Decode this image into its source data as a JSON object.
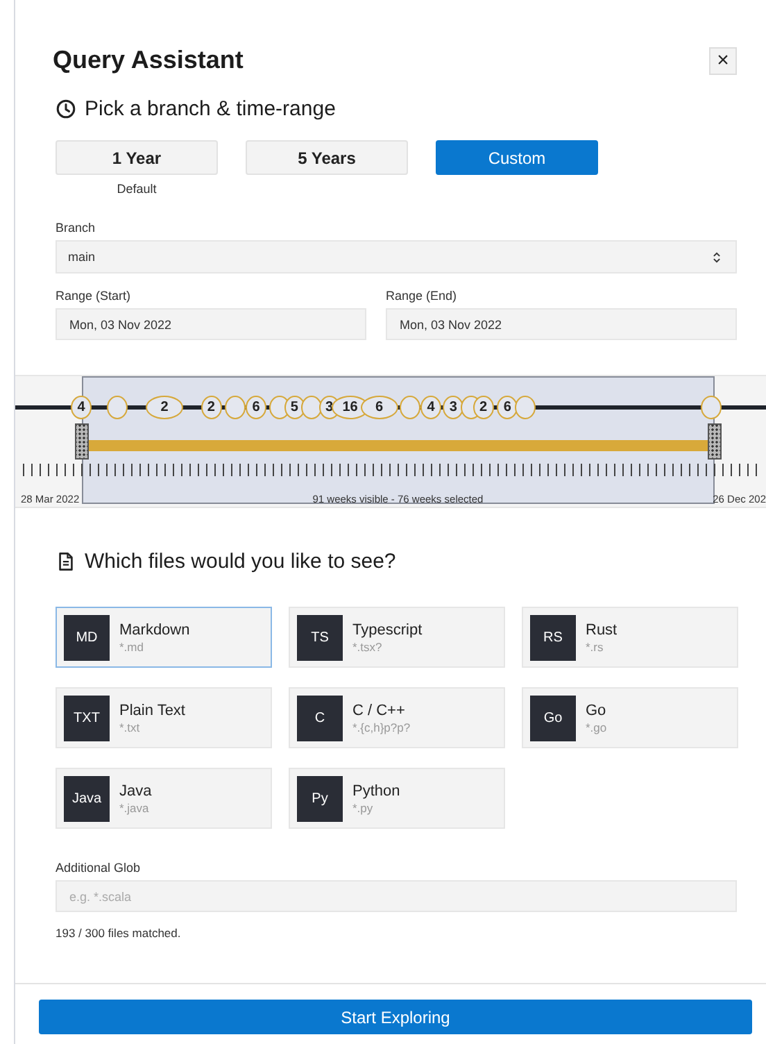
{
  "dialog": {
    "title": "Query Assistant",
    "close": "×"
  },
  "range_section": {
    "heading": "Pick a branch & time-range",
    "presets": [
      {
        "label": "1 Year",
        "note": "Default",
        "selected": false
      },
      {
        "label": "5 Years",
        "selected": false
      },
      {
        "label": "Custom",
        "selected": true
      }
    ],
    "branch": {
      "label": "Branch",
      "value": "main"
    },
    "range_start": {
      "label": "Range (Start)",
      "value": "Mon, 03 Nov 2022"
    },
    "range_end": {
      "label": "Range (End)",
      "value": "Mon, 03 Nov 2022"
    }
  },
  "timeline": {
    "bubbles": [
      {
        "label": "4",
        "kind": "round"
      },
      {
        "kind": "round"
      },
      {
        "label": "2",
        "kind": "wide"
      },
      {
        "label": "2",
        "kind": "round"
      },
      {
        "kind": "round"
      },
      {
        "label": "6",
        "kind": "round"
      },
      {
        "kind": "round"
      },
      {
        "label": "5",
        "kind": "round"
      },
      {
        "kind": "round"
      },
      {
        "label": "3",
        "kind": "round"
      },
      {
        "label": "16",
        "kind": "wide"
      },
      {
        "label": "6",
        "kind": "wide"
      },
      {
        "kind": "round"
      },
      {
        "label": "4",
        "kind": "round"
      },
      {
        "label": "3",
        "kind": "round"
      },
      {
        "kind": "round"
      },
      {
        "label": "2",
        "kind": "round"
      },
      {
        "label": "6",
        "kind": "round"
      },
      {
        "kind": "round"
      },
      {
        "kind": "round"
      }
    ],
    "handles": [
      {
        "level": 0.087
      },
      {
        "level": 0.923
      }
    ],
    "start_label": "28 Mar 2022",
    "summary": "91 weeks visible - 76 weeks selected",
    "end_label": "26 Dec 202"
  },
  "files_section": {
    "heading": "Which files would you like to see?",
    "options": [
      {
        "abbr": "MD",
        "name": "Markdown",
        "glob": "*.md",
        "selected": true
      },
      {
        "abbr": "TS",
        "name": "Typescript",
        "glob": "*.tsx?",
        "selected": false
      },
      {
        "abbr": "RS",
        "name": "Rust",
        "glob": "*.rs",
        "selected": false
      },
      {
        "abbr": "TXT",
        "name": "Plain Text",
        "glob": "*.txt",
        "selected": false
      },
      {
        "abbr": "C",
        "name": "C / C++",
        "glob": "*.{c,h}p?p?",
        "selected": false
      },
      {
        "abbr": "Go",
        "name": "Go",
        "glob": "*.go",
        "selected": false
      },
      {
        "abbr": "Java",
        "name": "Java",
        "glob": "*.java",
        "selected": false
      },
      {
        "abbr": "Py",
        "name": "Python",
        "glob": "*.py",
        "selected": false
      }
    ],
    "glob": {
      "label": "Additional Glob",
      "placeholder": "e.g. *.scala"
    },
    "matched": "193 / 300 files matched."
  },
  "footer": {
    "button": "Start Exploring"
  }
}
